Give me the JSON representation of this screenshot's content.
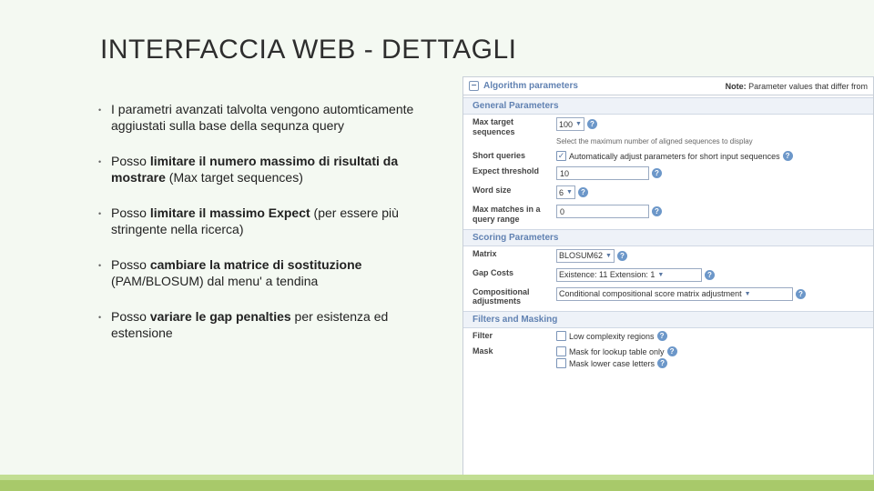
{
  "title": "INTERFACCIA WEB - DETTAGLI",
  "bullets": {
    "b1": {
      "full": "I parametri avanzati talvolta vengono automticamente aggiustati sulla base della sequnza query"
    },
    "b2": {
      "pre": "Posso ",
      "bold": "limitare il numero massimo di risultati da mostrare",
      "post": " (Max target sequences)"
    },
    "b3": {
      "pre": "Posso ",
      "bold": "limitare il massimo Expect",
      "post": " (per essere più stringente nella ricerca)"
    },
    "b4": {
      "pre": "Posso ",
      "bold": "cambiare la matrice di sostituzione",
      "post": " (PAM/BLOSUM) dal menu' a tendina"
    },
    "b5": {
      "pre": "Posso ",
      "bold": "variare le gap penalties",
      "post": " per esistenza ed estensione"
    }
  },
  "panel": {
    "top_label": "Algorithm parameters",
    "note_bold": "Note:",
    "note_rest": " Parameter values that differ from",
    "sec1": "General Parameters",
    "max_target_lab": "Max target sequences",
    "max_target_val": "100",
    "max_target_sub": "Select the maximum number of aligned sequences to display",
    "short_q_lab": "Short queries",
    "short_q_txt": "Automatically adjust parameters for short input sequences",
    "expect_lab": "Expect threshold",
    "expect_val": "10",
    "word_lab": "Word size",
    "word_val": "6",
    "maxmatch_lab": "Max matches in a query range",
    "maxmatch_val": "0",
    "sec2": "Scoring Parameters",
    "matrix_lab": "Matrix",
    "matrix_val": "BLOSUM62",
    "gap_lab": "Gap Costs",
    "gap_val": "Existence: 11 Extension: 1",
    "comp_lab": "Compositional adjustments",
    "comp_val": "Conditional compositional score matrix adjustment",
    "sec3": "Filters and Masking",
    "filter_lab": "Filter",
    "filter_txt": "Low complexity regions",
    "mask_lab": "Mask",
    "mask1": "Mask for lookup table only",
    "mask2": "Mask lower case letters"
  }
}
